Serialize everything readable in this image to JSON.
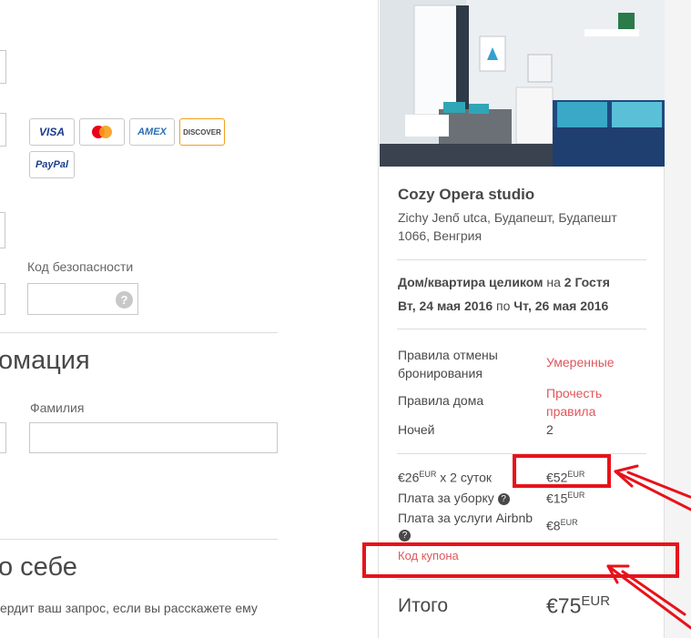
{
  "payment": {
    "cards": [
      "VISA",
      "AMEX",
      "DISCOVER",
      "PayPal"
    ],
    "security_code_label": "Код безопасности",
    "help_icon": "?"
  },
  "info": {
    "heading": "омация",
    "lastname_label": "Фамилия"
  },
  "about": {
    "heading": "о себе",
    "text": "ердит ваш запрос, если вы расскажете ему"
  },
  "listing": {
    "title": "Cozy Opera studio",
    "address_line1": "Zichy Jenő utca, Будапешт, Будапешт",
    "address_line2": "1066, Венгрия",
    "type_bold": "Дом/квартира целиком",
    "type_mid": " на ",
    "guests_bold": "2 Гостя",
    "date_from": "Вт, 24 мая 2016",
    "date_mid": " по ",
    "date_to": "Чт, 26 мая 2016"
  },
  "rules": {
    "cancel_label_1": "Правила отмены",
    "cancel_label_2": "бронирования",
    "cancel_value": "Умеренные",
    "house_label": "Правила дома",
    "house_value_1": "Прочесть",
    "house_value_2": "правила",
    "nights_label": "Ночей",
    "nights_value": "2"
  },
  "pricing": {
    "nightly_price": "€26",
    "nightly_sup": "EUR",
    "nightly_suffix": " x 2 суток",
    "nightly_total": "€52",
    "nightly_total_sup": "EUR",
    "cleaning_label": "Плата за уборку",
    "cleaning_value": "€15",
    "cleaning_sup": "EUR",
    "service_label": "Плата за услуги Airbnb",
    "service_value": "€8",
    "service_sup": "EUR",
    "coupon_label": "Код купона",
    "total_label": "Итого",
    "total_value": "€75",
    "total_sup": "EUR"
  },
  "colors": {
    "accent": "#e0565b",
    "annotation": "#e8121a"
  }
}
